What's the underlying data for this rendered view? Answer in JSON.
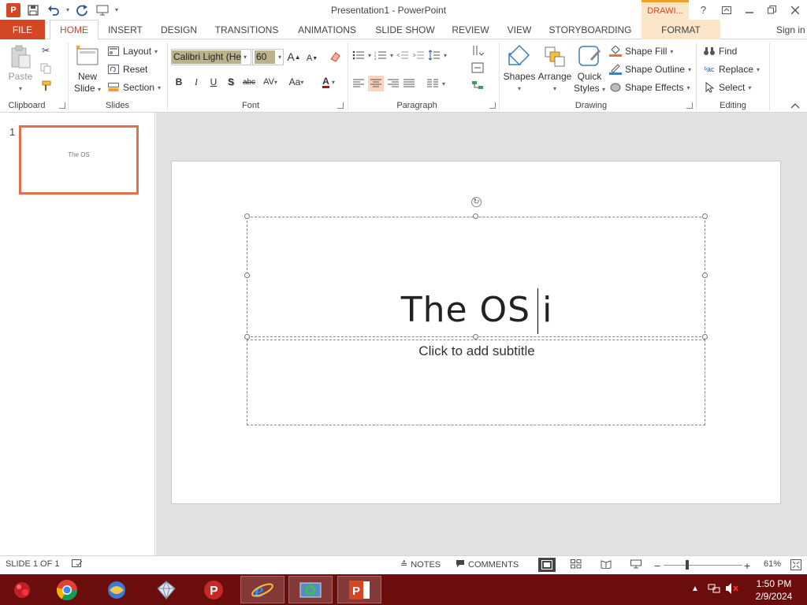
{
  "window": {
    "title": "Presentation1 - PowerPoint",
    "contextual_tab_group": "DRAWI...",
    "help": "?",
    "sign_in": "Sign in"
  },
  "qat": {
    "icons": [
      "powerpoint-logo",
      "save-icon",
      "undo-icon",
      "redo-icon",
      "start-from-beginning-icon",
      "customize-qat-icon"
    ]
  },
  "tabs": {
    "file": "FILE",
    "home": "HOME",
    "insert": "INSERT",
    "design": "DESIGN",
    "transitions": "TRANSITIONS",
    "animations": "ANIMATIONS",
    "slideshow": "SLIDE SHOW",
    "review": "REVIEW",
    "view": "VIEW",
    "storyboarding": "STORYBOARDING",
    "format": "FORMAT"
  },
  "ribbon": {
    "clipboard": {
      "label": "Clipboard",
      "paste": "Paste"
    },
    "slides": {
      "label": "Slides",
      "new_slide_1": "New",
      "new_slide_2": "Slide",
      "layout": "Layout",
      "reset": "Reset",
      "section": "Section"
    },
    "font": {
      "label": "Font",
      "name": "Calibri Light (He",
      "size": "60",
      "bold": "B",
      "italic": "I",
      "underline": "U",
      "shadow": "S",
      "strike": "abc",
      "spacing": "AV",
      "case": "Aa",
      "color": "A",
      "grow": "A",
      "shrink": "A"
    },
    "paragraph": {
      "label": "Paragraph"
    },
    "drawing": {
      "label": "Drawing",
      "shapes": "Shapes",
      "arrange": "Arrange",
      "quick_styles_1": "Quick",
      "quick_styles_2": "Styles",
      "shape_fill": "Shape Fill",
      "shape_outline": "Shape Outline",
      "shape_effects": "Shape Effects"
    },
    "editing": {
      "label": "Editing",
      "find": "Find",
      "replace": "Replace",
      "select": "Select"
    }
  },
  "thumbnails": [
    {
      "number": "1",
      "text": "The OS"
    }
  ],
  "slide": {
    "title": "The OS i",
    "subtitle_placeholder": "Click to add subtitle"
  },
  "status": {
    "slide_info": "SLIDE 1 OF 1",
    "notes": "NOTES",
    "comments": "COMMENTS",
    "zoom": "61%"
  },
  "taskbar": {
    "time": "1:50 PM",
    "date": "2/9/2024",
    "apps": [
      "app-red-icon",
      "chrome-icon",
      "app-globe-icon",
      "app-diamond-icon",
      "app-p-icon",
      "internet-explorer-icon",
      "app-sync-icon",
      "powerpoint-icon"
    ]
  },
  "colors": {
    "accent": "#d24726",
    "taskbar": "#6b0d0d",
    "contextual": "#fbe6c9",
    "selection": "#b9b28a"
  }
}
